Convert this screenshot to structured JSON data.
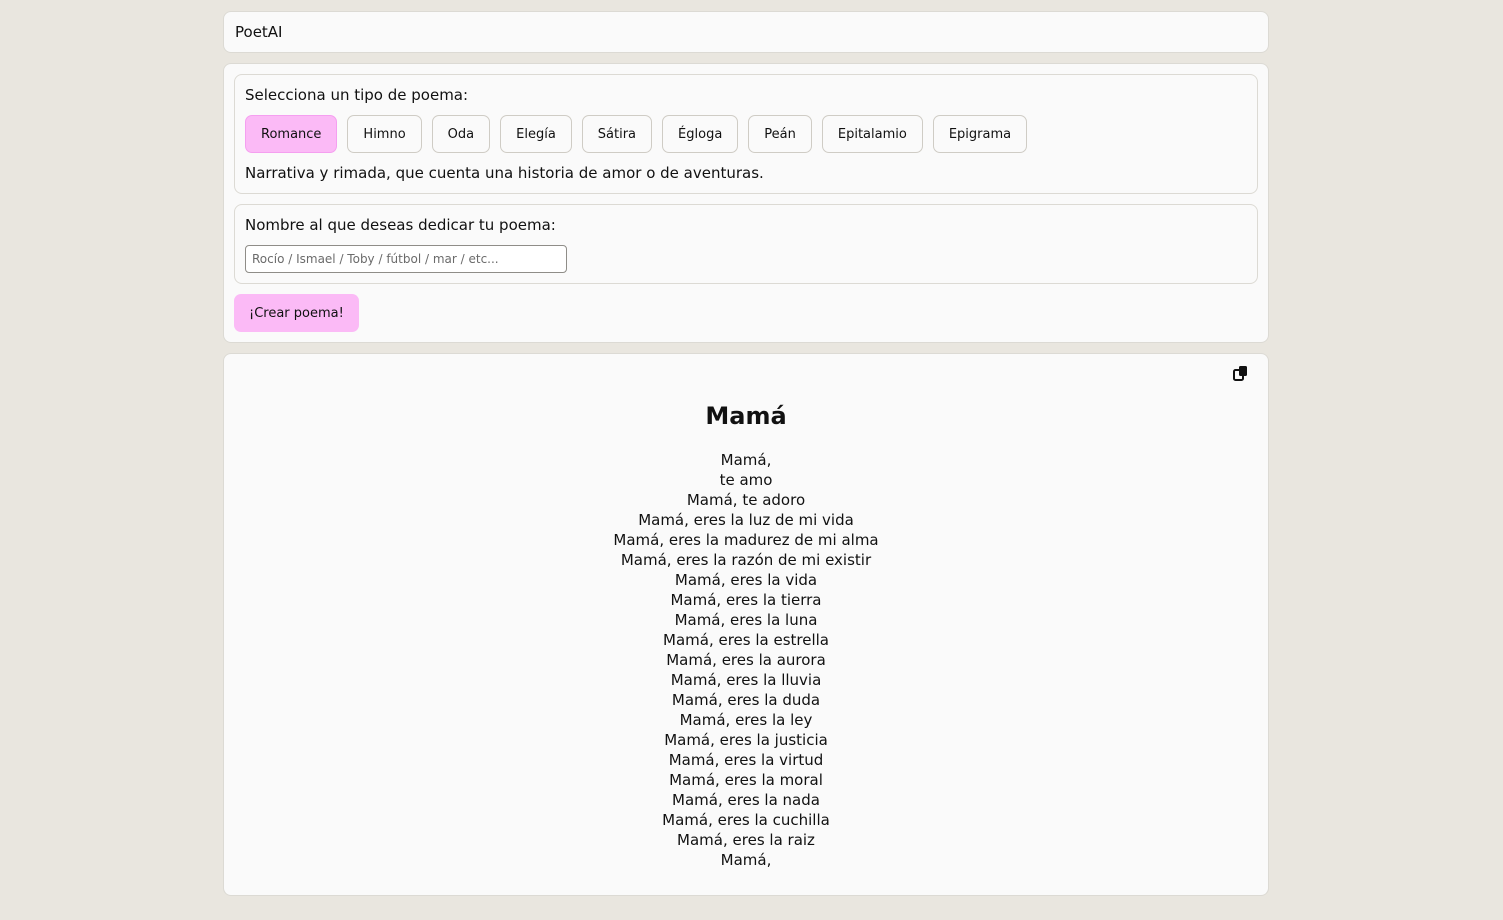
{
  "app": {
    "title": "PoetAI"
  },
  "form": {
    "type_label": "Selecciona un tipo de poema:",
    "types": [
      {
        "label": "Romance",
        "selected": true
      },
      {
        "label": "Himno",
        "selected": false
      },
      {
        "label": "Oda",
        "selected": false
      },
      {
        "label": "Elegía",
        "selected": false
      },
      {
        "label": "Sátira",
        "selected": false
      },
      {
        "label": "Égloga",
        "selected": false
      },
      {
        "label": "Peán",
        "selected": false
      },
      {
        "label": "Epitalamio",
        "selected": false
      },
      {
        "label": "Epigrama",
        "selected": false
      }
    ],
    "type_description": "Narrativa y rimada, que cuenta una historia de amor o de aventuras.",
    "name_label": "Nombre al que deseas dedicar tu poema:",
    "name_value": "",
    "name_placeholder": "Rocío / Ismael / Toby / fútbol / mar / etc...",
    "create_label": "¡Crear poema!"
  },
  "poem": {
    "copy_icon": "copy-icon",
    "title": "Mamá",
    "lines": [
      "Mamá,",
      "te amo",
      "Mamá, te adoro",
      "Mamá, eres la luz de mi vida",
      "Mamá, eres la madurez de mi alma",
      "Mamá, eres la razón de mi existir",
      "Mamá, eres la vida",
      "Mamá, eres la tierra",
      "Mamá, eres la luna",
      "Mamá, eres la estrella",
      "Mamá, eres la aurora",
      "Mamá, eres la lluvia",
      "Mamá, eres la duda",
      "Mamá, eres la ley",
      "Mamá, eres la justicia",
      "Mamá, eres la virtud",
      "Mamá, eres la moral",
      "Mamá, eres la nada",
      "Mamá, eres la cuchilla",
      "Mamá, eres la raiz",
      "Mamá,"
    ]
  },
  "colors": {
    "background": "#e9e6df",
    "card": "#fafafa",
    "accent_pink": "#fbbaf6"
  }
}
